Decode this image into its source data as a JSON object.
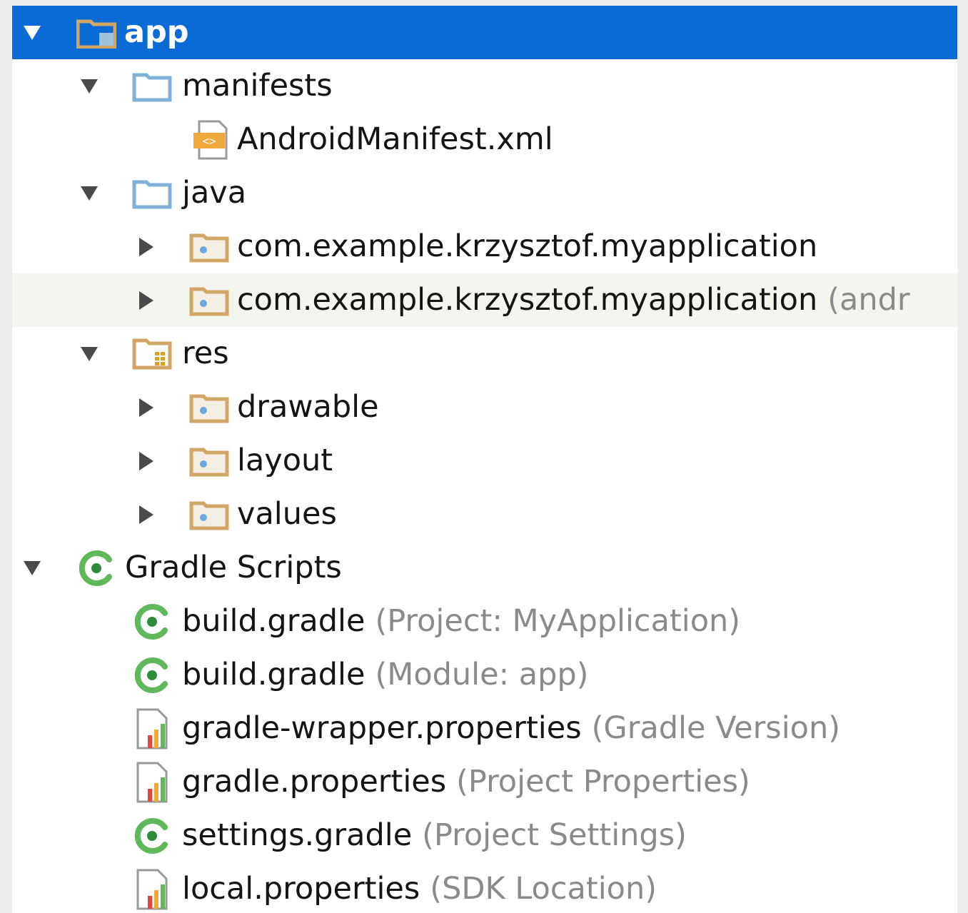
{
  "tree": {
    "app": {
      "label": "app"
    },
    "manifests": {
      "label": "manifests"
    },
    "manifest_file": {
      "label": "AndroidManifest.xml"
    },
    "java": {
      "label": "java"
    },
    "pkg_main": {
      "label": "com.example.krzysztof.myapplication"
    },
    "pkg_test": {
      "label": "com.example.krzysztof.myapplication",
      "hint": "(andr"
    },
    "res": {
      "label": "res"
    },
    "drawable": {
      "label": "drawable"
    },
    "layout": {
      "label": "layout"
    },
    "values": {
      "label": "values"
    },
    "gradle_scripts": {
      "label": "Gradle Scripts"
    },
    "build_project": {
      "label": "build.gradle",
      "hint": "(Project: MyApplication)"
    },
    "build_module": {
      "label": "build.gradle",
      "hint": "(Module: app)"
    },
    "wrapper_props": {
      "label": "gradle-wrapper.properties",
      "hint": "(Gradle Version)"
    },
    "gradle_props": {
      "label": "gradle.properties",
      "hint": "(Project Properties)"
    },
    "settings_gradle": {
      "label": "settings.gradle",
      "hint": "(Project Settings)"
    },
    "local_props": {
      "label": "local.properties",
      "hint": "(SDK Location)"
    }
  },
  "icons": {
    "expanded": "triangle-down-icon",
    "collapsed": "triangle-right-icon",
    "module": "module-folder-icon",
    "folder": "folder-icon",
    "package": "package-folder-icon",
    "res_folder": "resource-folder-icon",
    "xml_file": "xml-file-icon",
    "gradle": "gradle-icon",
    "properties_file": "properties-file-icon"
  },
  "colors": {
    "selection": "#0a6bd6",
    "hover_row": "#f3f6ee",
    "hint_text": "#8a8a8a",
    "gradle_green": "#5fb85c",
    "folder_blue": "#7fb0d8",
    "folder_tan": "#d2a766"
  }
}
